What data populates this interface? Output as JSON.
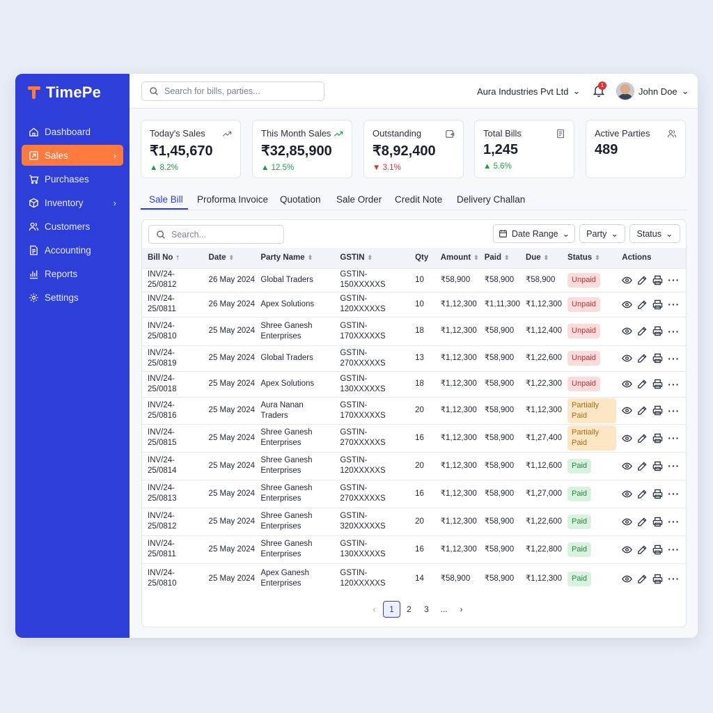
{
  "app": {
    "name": "TimePe"
  },
  "sidebar": {
    "items": [
      {
        "label": "Dashboard",
        "icon": "home-icon"
      },
      {
        "label": "Sales",
        "icon": "sales-icon",
        "active": true,
        "chevron": true
      },
      {
        "label": "Purchases",
        "icon": "cart-icon"
      },
      {
        "label": "Inventory",
        "icon": "box-icon",
        "chevron": true
      },
      {
        "label": "Customers",
        "icon": "users-icon"
      },
      {
        "label": "Accounting",
        "icon": "document-icon"
      },
      {
        "label": "Reports",
        "icon": "chart-icon"
      },
      {
        "label": "Settings",
        "icon": "gear-icon"
      }
    ]
  },
  "header": {
    "search_placeholder": "Search for bills, parties...",
    "company": "Aura Industries Pvt Ltd",
    "notification_count": "1",
    "user_name": "John Doe"
  },
  "stats": [
    {
      "label": "Today's Sales",
      "value": "₹1,45,670",
      "change": "8.2%",
      "direction": "up",
      "icon": "trend-up-icon"
    },
    {
      "label": "This Month Sales",
      "value": "₹32,85,900",
      "change": "12.5%",
      "direction": "up",
      "icon": "trend-up-icon"
    },
    {
      "label": "Outstanding",
      "value": "₹8,92,400",
      "change": "3.1%",
      "direction": "down",
      "icon": "wallet-icon"
    },
    {
      "label": "Total Bills",
      "value": "1,245",
      "change": "5.6%",
      "direction": "up",
      "icon": "bill-icon"
    },
    {
      "label": "Active Parties",
      "value": "489",
      "change": "",
      "direction": "",
      "icon": "users-icon"
    }
  ],
  "tabs": [
    "Sale Bill",
    "Proforma Invoice",
    "Quotation",
    "Sale Order",
    "Credit Note",
    "Delivery Challan"
  ],
  "toolbar": {
    "search_placeholder": "Search...",
    "date_range": "Date Range",
    "party": "Party",
    "status": "Status"
  },
  "table": {
    "columns": [
      "Bill No",
      "Date",
      "Party Name",
      "GSTIN",
      "Qty",
      "Amount",
      "Paid",
      "Due",
      "Status",
      "Actions"
    ],
    "rows": [
      {
        "bill": "INV/24-25/0812",
        "date": "26 May 2024",
        "party": "Global Traders",
        "gstin": "GSTIN-150XXXXXS",
        "qty": "10",
        "amount": "₹58,900",
        "paid": "₹58,900",
        "due": "₹58,900",
        "status": "Unpaid"
      },
      {
        "bill": "INV/24-25/0811",
        "date": "26 May 2024",
        "party": "Apex Solutions",
        "gstin": "GSTIN-120XXXXXS",
        "qty": "10",
        "amount": "₹1,12,300",
        "paid": "₹1,11,300",
        "due": "₹1,12,300",
        "status": "Unpaid"
      },
      {
        "bill": "INV/24-25/0810",
        "date": "25 May 2024",
        "party": "Shree Ganesh Enterprises",
        "gstin": "GSTIN-170XXXXXS",
        "qty": "18",
        "amount": "₹1,12,300",
        "paid": "₹58,900",
        "due": "₹1,12,400",
        "status": "Unpaid"
      },
      {
        "bill": "INV/24-25/0819",
        "date": "25 May 2024",
        "party": "Global Traders",
        "gstin": "GSTIN-270XXXXXS",
        "qty": "13",
        "amount": "₹1,12,300",
        "paid": "₹58,900",
        "due": "₹1,22,600",
        "status": "Unpaid"
      },
      {
        "bill": "INV/24-25/0018",
        "date": "25 May 2024",
        "party": "Apex Solutions",
        "gstin": "GSTIN-130XXXXXS",
        "qty": "18",
        "amount": "₹1,12,300",
        "paid": "₹58,900",
        "due": "₹1,22,300",
        "status": "Unpaid"
      },
      {
        "bill": "INV/24-25/0816",
        "date": "25 May 2024",
        "party": "Aura Nanan Traders",
        "gstin": "GSTIN-170XXXXXS",
        "qty": "20",
        "amount": "₹1,12,300",
        "paid": "₹58,900",
        "due": "₹1,12,300",
        "status": "Partially Paid"
      },
      {
        "bill": "INV/24-25/0815",
        "date": "25 May 2024",
        "party": "Shree Ganesh Enterprises",
        "gstin": "GSTIN-270XXXXXS",
        "qty": "16",
        "amount": "₹1,12,300",
        "paid": "₹58,900",
        "due": "₹1,27,400",
        "status": "Partially Paid"
      },
      {
        "bill": "INV/24-25/0814",
        "date": "25 May 2024",
        "party": "Shree Ganesh Enterprises",
        "gstin": "GSTIN-120XXXXXS",
        "qty": "20",
        "amount": "₹1,12,300",
        "paid": "₹58,900",
        "due": "₹1,12,600",
        "status": "Paid"
      },
      {
        "bill": "INV/24-25/0813",
        "date": "25 May 2024",
        "party": "Shree Ganesh Enterprises",
        "gstin": "GSTIN-270XXXXXS",
        "qty": "16",
        "amount": "₹1,12,300",
        "paid": "₹58,900",
        "due": "₹1,27,000",
        "status": "Paid"
      },
      {
        "bill": "INV/24-25/0812",
        "date": "25 May 2024",
        "party": "Shree Ganesh Enterprises",
        "gstin": "GSTIN-320XXXXXS",
        "qty": "20",
        "amount": "₹1,12,300",
        "paid": "₹58,900",
        "due": "₹1,22,600",
        "status": "Paid"
      },
      {
        "bill": "INV/24-25/0811",
        "date": "25 May 2024",
        "party": "Shree Ganesh Enterprises",
        "gstin": "GSTIN-130XXXXXS",
        "qty": "16",
        "amount": "₹1,12,300",
        "paid": "₹58,900",
        "due": "₹1,22,800",
        "status": "Paid"
      },
      {
        "bill": "INV/24-25/0810",
        "date": "25 May 2024",
        "party": "Apex Ganesh Enterprises",
        "gstin": "GSTIN-120XXXXXS",
        "qty": "14",
        "amount": "₹58,900",
        "paid": "₹58,900",
        "due": "₹1,12,300",
        "status": "Paid"
      }
    ]
  },
  "pagination": {
    "current": "1",
    "pages": [
      "1",
      "2",
      "3",
      "..."
    ]
  },
  "colors": {
    "primary": "#2e3fd9",
    "accent": "#ff7a3d",
    "up": "#1f9a4c",
    "down": "#d93030"
  }
}
